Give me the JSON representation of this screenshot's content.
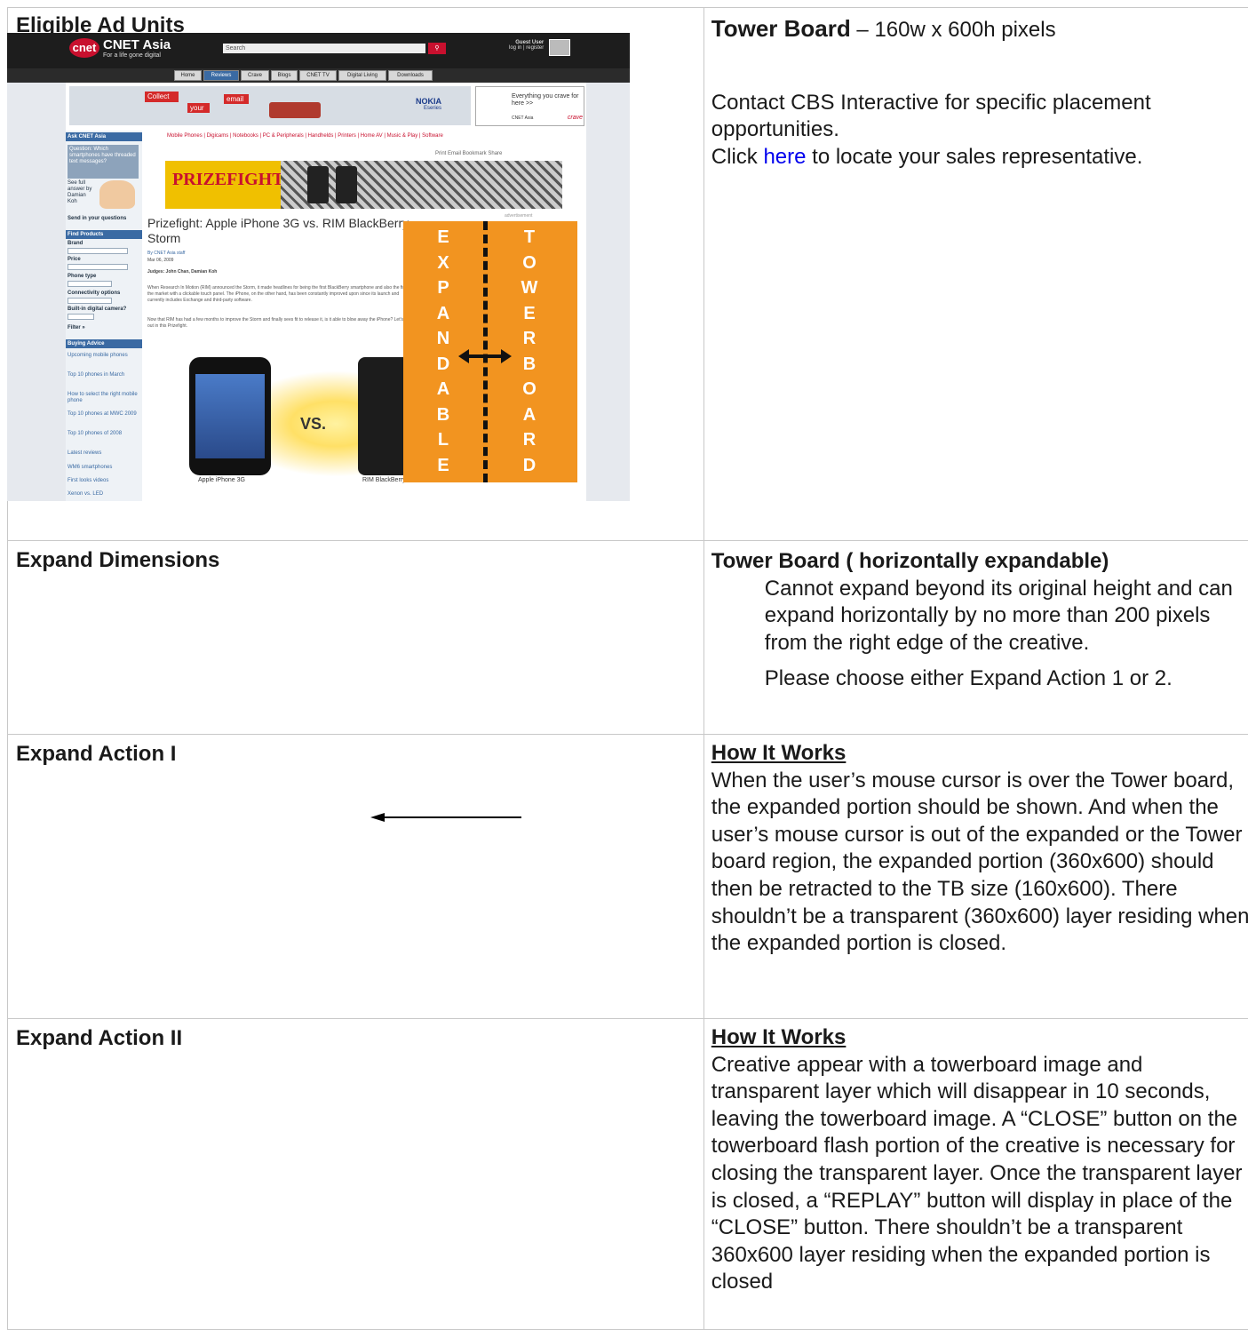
{
  "rows": [
    {
      "left_heading": "Eligible Ad Units",
      "right": {
        "title_bold": "Tower Board",
        "title_rest": " – 160w x 600h pixels",
        "para1": "Contact CBS Interactive for specific placement opportunities.",
        "para2_before": "Click ",
        "para2_link": "here",
        "para2_after": " to locate your sales representative."
      }
    },
    {
      "left_heading": "Expand Dimensions",
      "right": {
        "title_bold": "Tower Board ( horizontally expandable)",
        "para1": "Cannot expand beyond its original height and can expand horizontally by no more than 200 pixels from the right edge of the creative.",
        "para2": "Please choose either Expand Action 1 or 2."
      }
    },
    {
      "left_heading": "Expand Action I",
      "right": {
        "subtitle": "How It Works",
        "body": "When the user’s mouse cursor is over the Tower board, the expanded portion should be shown. And when the user’s mouse cursor is out of the expanded or the Tower board region, the expanded portion (360x600) should then be retracted to the TB size (160x600). There shouldn’t be a transparent (360x600) layer residing when the expanded portion is closed."
      }
    },
    {
      "left_heading": "Expand Action II",
      "right": {
        "subtitle": "How It Works",
        "body": "Creative appear with a towerboard image and transparent layer which will disappear in 10 seconds, leaving the towerboard image. A “CLOSE” button on the towerboard flash portion of the creative is necessary for closing the transparent layer. Once the transparent layer is closed, a “REPLAY” button will display in place of the “CLOSE” button. There shouldn’t be a transparent 360x600 layer residing when the expanded portion is closed"
      }
    }
  ],
  "screenshot": {
    "logo": "cnet",
    "brand": "CNET Asia",
    "tagline": "For a life gone digital",
    "search_placeholder": "Search",
    "guest": "Guest User",
    "guest_sub": "log in | register",
    "nav": [
      "Home",
      "Reviews",
      "Crave",
      "Blogs",
      "CNET TV",
      "Digital Living",
      "Downloads"
    ],
    "banner_collect": "Collect",
    "banner_your": "your",
    "banner_email": "email",
    "banner_nokia": "NOKIA",
    "banner_nokia_sub": "Eseries",
    "ad2_text": "Everything you crave for here >>",
    "ad2_crave": "crave",
    "ad2_cnetasia": "CNET Asia",
    "side_ask": "Ask CNET Asia",
    "side_question": "Question: Which smartphones have threaded text messages?",
    "side_answer": "See full answer by Damian Koh",
    "side_send": "Send in your questions",
    "side_find": "Find Products",
    "side_brand": "Brand",
    "side_price": "Price",
    "side_phonetype": "Phone type",
    "side_conn": "Connectivity options",
    "side_camera": "Built-in digital camera?",
    "side_filter": "Filter »",
    "side_buying": "Buying Advice",
    "side_links": [
      "Upcoming mobile phones",
      "Top 10 phones in March",
      "How to select the right mobile phone",
      "Top 10 phones at MWC 2009",
      "Top 10 phones of 2008",
      "Latest reviews",
      "WM6 smartphones",
      "First looks videos",
      "Xenon vs. LED"
    ],
    "catnav": "Mobile Phones  |  Digicams  |  Notebooks  |  PC & Peripherals  |  Handhelds  |  Printers  |  Home AV  |  Music & Play  |  Software",
    "tools": "Print  Email  Bookmark  Share",
    "prize_word": "PRIZEFIGHT",
    "advertisement": "advertisement",
    "article_title": "Prizefight: Apple iPhone 3G vs. RIM BlackBerry Storm",
    "byline": "By CNET Asia staff",
    "date": "Mar 06, 2009",
    "judges": "Judges: John Chan, Damian Koh",
    "body1": "When Research In Motion (RIM) announced the Storm, it made headlines for being the first BlackBerry smartphone and also the first in the market with a clickable touch panel. The iPhone, on the other hand, has been constantly improved upon since its launch and currently includes Exchange and third-party software.",
    "body2": "Now that RIM has had a few months to improve the Storm and finally sees fit to release it, is it able to blow away the iPhone? Let's find out in this Prizefight.",
    "vs": "VS.",
    "cap_iphone": "Apple iPhone 3G",
    "cap_bb": "RIM BlackBerry",
    "expandable_letters": [
      "E",
      "X",
      "P",
      "A",
      "N",
      "D",
      "A",
      "B",
      "L",
      "E"
    ],
    "towerboard_letters": [
      "T",
      "O",
      "W",
      "E",
      "R",
      "B",
      "O",
      "A",
      "R",
      "D"
    ]
  }
}
